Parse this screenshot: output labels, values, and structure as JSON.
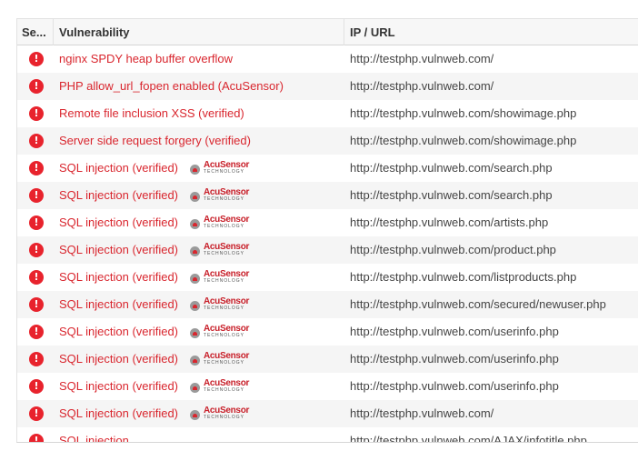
{
  "table": {
    "columns": {
      "severity": "Se...",
      "vulnerability": "Vulnerability",
      "url": "IP / URL"
    },
    "acusensor_badge": {
      "name": "AcuSensor",
      "sub": "TECHNOLOGY"
    },
    "colors": {
      "severity_high": "#e8232d",
      "vuln_text": "#d9262e",
      "row_alt": "#f5f5f5"
    },
    "rows": [
      {
        "severity": "!",
        "name": "nginx SPDY heap buffer overflow",
        "acusensor": false,
        "url": "http://testphp.vulnweb.com/"
      },
      {
        "severity": "!",
        "name": "PHP allow_url_fopen enabled (AcuSensor)",
        "acusensor": false,
        "url": "http://testphp.vulnweb.com/"
      },
      {
        "severity": "!",
        "name": "Remote file inclusion XSS (verified)",
        "acusensor": false,
        "url": "http://testphp.vulnweb.com/showimage.php"
      },
      {
        "severity": "!",
        "name": "Server side request forgery (verified)",
        "acusensor": false,
        "url": "http://testphp.vulnweb.com/showimage.php"
      },
      {
        "severity": "!",
        "name": "SQL injection (verified)",
        "acusensor": true,
        "url": "http://testphp.vulnweb.com/search.php"
      },
      {
        "severity": "!",
        "name": "SQL injection (verified)",
        "acusensor": true,
        "url": "http://testphp.vulnweb.com/search.php"
      },
      {
        "severity": "!",
        "name": "SQL injection (verified)",
        "acusensor": true,
        "url": "http://testphp.vulnweb.com/artists.php"
      },
      {
        "severity": "!",
        "name": "SQL injection (verified)",
        "acusensor": true,
        "url": "http://testphp.vulnweb.com/product.php"
      },
      {
        "severity": "!",
        "name": "SQL injection (verified)",
        "acusensor": true,
        "url": "http://testphp.vulnweb.com/listproducts.php"
      },
      {
        "severity": "!",
        "name": "SQL injection (verified)",
        "acusensor": true,
        "url": "http://testphp.vulnweb.com/secured/newuser.php"
      },
      {
        "severity": "!",
        "name": "SQL injection (verified)",
        "acusensor": true,
        "url": "http://testphp.vulnweb.com/userinfo.php"
      },
      {
        "severity": "!",
        "name": "SQL injection (verified)",
        "acusensor": true,
        "url": "http://testphp.vulnweb.com/userinfo.php"
      },
      {
        "severity": "!",
        "name": "SQL injection (verified)",
        "acusensor": true,
        "url": "http://testphp.vulnweb.com/userinfo.php"
      },
      {
        "severity": "!",
        "name": "SQL injection (verified)",
        "acusensor": true,
        "url": "http://testphp.vulnweb.com/"
      },
      {
        "severity": "!",
        "name": "SQL injection",
        "acusensor": false,
        "url": "http://testphp.vulnweb.com/AJAX/infotitle.php"
      }
    ]
  }
}
